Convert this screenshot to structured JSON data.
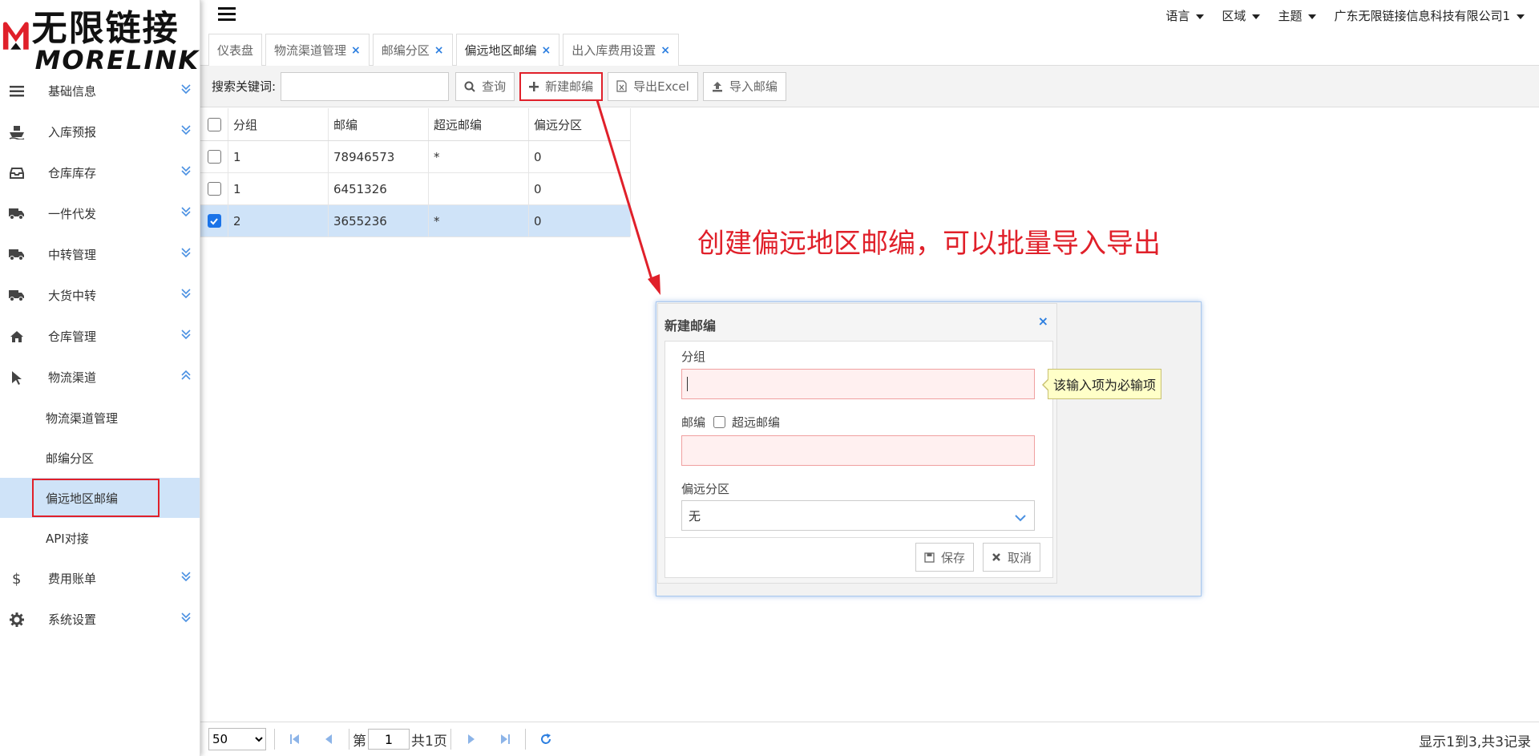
{
  "brand": {
    "name_cn": "无限链接",
    "name_en": "MORELINK",
    "accent": "#e0202a"
  },
  "sidebar": {
    "items": [
      {
        "label": "基础信息",
        "icon": "list-icon"
      },
      {
        "label": "入库预报",
        "icon": "ship-icon"
      },
      {
        "label": "仓库库存",
        "icon": "inbox-icon"
      },
      {
        "label": "一件代发",
        "icon": "truck-icon"
      },
      {
        "label": "中转管理",
        "icon": "truck-icon"
      },
      {
        "label": "大货中转",
        "icon": "truck-icon"
      },
      {
        "label": "仓库管理",
        "icon": "home-icon"
      },
      {
        "label": "物流渠道",
        "icon": "cursor-icon"
      }
    ],
    "sub_items": [
      "物流渠道管理",
      "邮编分区",
      "偏远地区邮编",
      "API对接"
    ],
    "bottom_items": [
      {
        "label": "费用账单",
        "icon": "dollar-icon"
      },
      {
        "label": "系统设置",
        "icon": "gear-icon"
      }
    ]
  },
  "topbar": {
    "language": "语言",
    "region": "区域",
    "theme": "主题",
    "company": "广东无限链接信息科技有限公司1"
  },
  "tabs": [
    "仪表盘",
    "物流渠道管理",
    "邮编分区",
    "偏远地区邮编",
    "出入库费用设置"
  ],
  "toolbar": {
    "search_label": "搜索关键词:",
    "search_value": "",
    "query": "查询",
    "new_zip": "新建邮编",
    "export_excel": "导出Excel",
    "import_zip": "导入邮编"
  },
  "table": {
    "columns": [
      "分组",
      "邮编",
      "超远邮编",
      "偏远分区"
    ],
    "rows": [
      {
        "group": "1",
        "zip": "78946573",
        "extra_remote": "*",
        "zone": "0",
        "checked": false
      },
      {
        "group": "1",
        "zip": "6451326",
        "extra_remote": "",
        "zone": "0",
        "checked": false
      },
      {
        "group": "2",
        "zip": "3655236",
        "extra_remote": "*",
        "zone": "0",
        "checked": true
      }
    ]
  },
  "annotation": "创建偏远地区邮编，可以批量导入导出",
  "dialog": {
    "title": "新建邮编",
    "group_label": "分组",
    "zip_label": "邮编",
    "extra_remote_label": "超远邮编",
    "zone_label": "偏远分区",
    "zone_value": "无",
    "tooltip": "该输入项为必输项",
    "save": "保存",
    "cancel": "取消"
  },
  "pager": {
    "page_size": "50",
    "page_prefix": "第",
    "page_value": "1",
    "page_suffix": "共1页",
    "summary": "显示1到3,共3记录"
  }
}
